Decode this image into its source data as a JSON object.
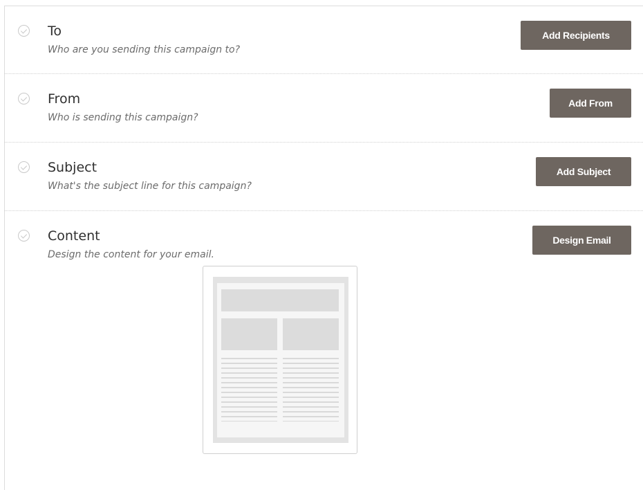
{
  "sections": {
    "to": {
      "title": "To",
      "subtitle": "Who are you sending this campaign to?",
      "button": "Add Recipients"
    },
    "from": {
      "title": "From",
      "subtitle": "Who is sending this campaign?",
      "button": "Add From"
    },
    "subject": {
      "title": "Subject",
      "subtitle": "What's the subject line for this campaign?",
      "button": "Add Subject"
    },
    "content": {
      "title": "Content",
      "subtitle": "Design the content for your email.",
      "button": "Design Email"
    }
  },
  "icons": {
    "status": "check-circle-icon",
    "preview": "email-template-preview"
  },
  "colors": {
    "button_bg": "#6e6660",
    "button_text": "#ffffff",
    "title": "#2f2f2f",
    "subtitle": "#6b6b6b",
    "check": "#c9c9c9"
  }
}
